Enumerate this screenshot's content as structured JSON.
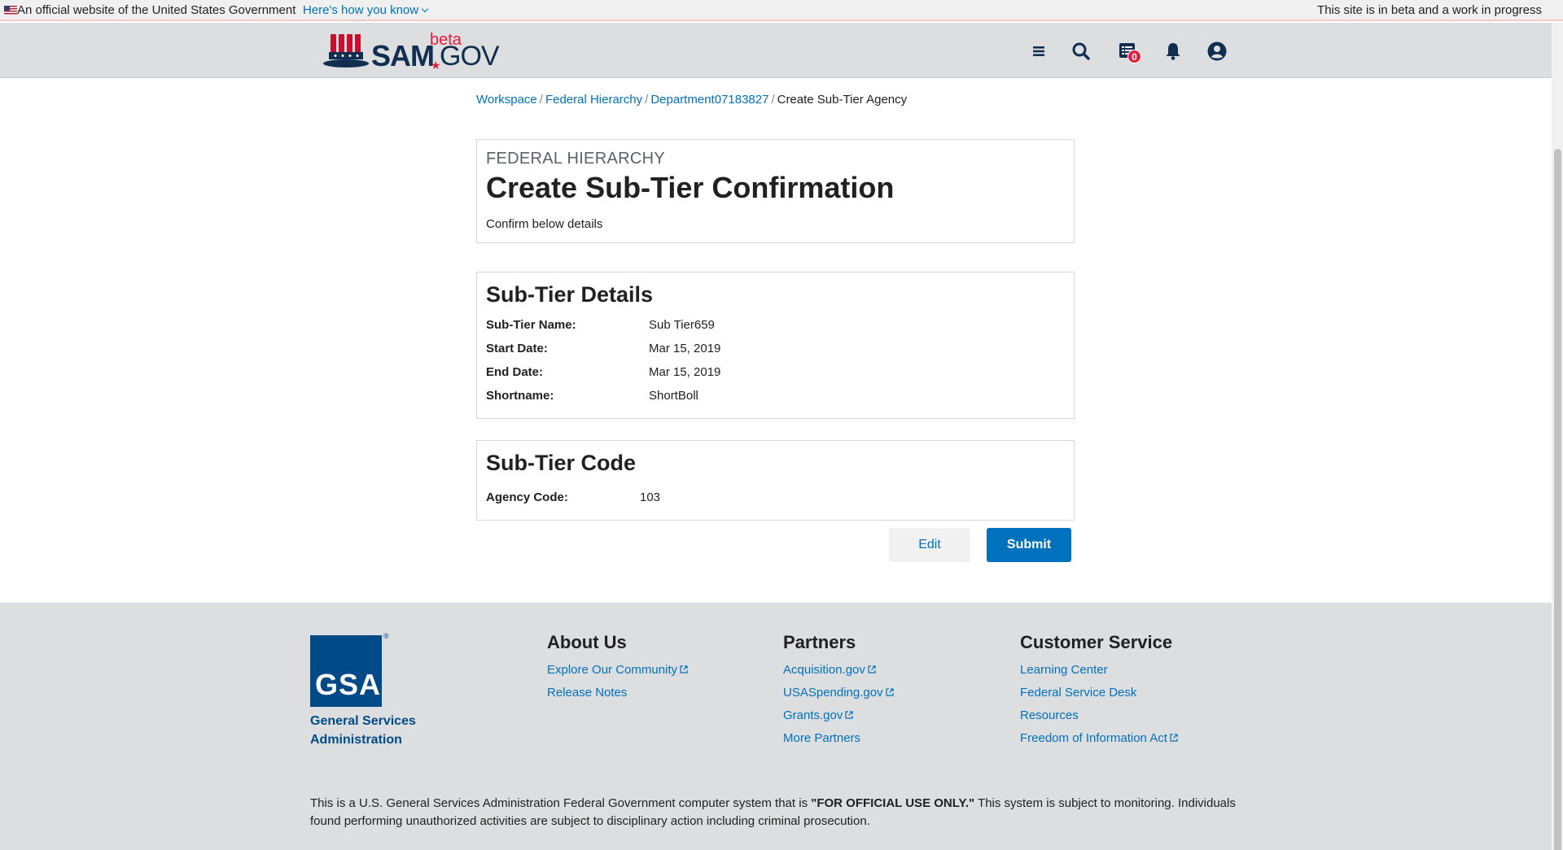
{
  "gov_banner": {
    "official_text": "An official website of the United States Government",
    "how_link": "Here's how you know",
    "beta_note": "This site is in beta and a work in progress"
  },
  "header": {
    "logo_sam": "SAM",
    "logo_gov": "GOV",
    "logo_beta": "beta",
    "notification_count": "0"
  },
  "breadcrumb": {
    "items": [
      "Workspace",
      "Federal Hierarchy",
      "Department07183827"
    ],
    "current": "Create Sub-Tier Agency"
  },
  "page": {
    "eyebrow": "FEDERAL HIERARCHY",
    "title": "Create Sub-Tier Confirmation",
    "subtitle": "Confirm below details"
  },
  "details": {
    "title": "Sub-Tier Details",
    "rows": [
      {
        "label": "Sub-Tier Name:",
        "value": "Sub Tier659"
      },
      {
        "label": "Start Date:",
        "value": "Mar 15, 2019"
      },
      {
        "label": "End Date:",
        "value": "Mar 15, 2019"
      },
      {
        "label": "Shortname:",
        "value": "ShortBoll"
      }
    ]
  },
  "code": {
    "title": "Sub-Tier Code",
    "label": "Agency Code:",
    "value": "103"
  },
  "actions": {
    "edit": "Edit",
    "submit": "Submit"
  },
  "footer": {
    "gsa_logo": "GSA",
    "gsa_name": "General Services Administration",
    "about": {
      "title": "About Us",
      "links": [
        "Explore Our Community",
        "Release Notes"
      ]
    },
    "partners": {
      "title": "Partners",
      "links": [
        "Acquisition.gov",
        "USASpending.gov",
        "Grants.gov",
        "More Partners"
      ]
    },
    "customer_service": {
      "title": "Customer Service",
      "links": [
        "Learning Center",
        "Federal Service Desk",
        "Resources",
        "Freedom of Information Act"
      ]
    },
    "disclaimer_pre": "This is a U.S. General Services Administration Federal Government computer system that is ",
    "disclaimer_bold": "\"FOR OFFICIAL USE ONLY.\"",
    "disclaimer_post": " This system is subject to monitoring. Individuals found performing unauthorized activities are subject to disciplinary action including criminal prosecution."
  },
  "colors": {
    "link": "#0071bc",
    "primary_button": "#0071bc",
    "gsa_blue": "#004b87",
    "badge_red": "#e31c3d",
    "header_bg": "#dcdee0"
  }
}
